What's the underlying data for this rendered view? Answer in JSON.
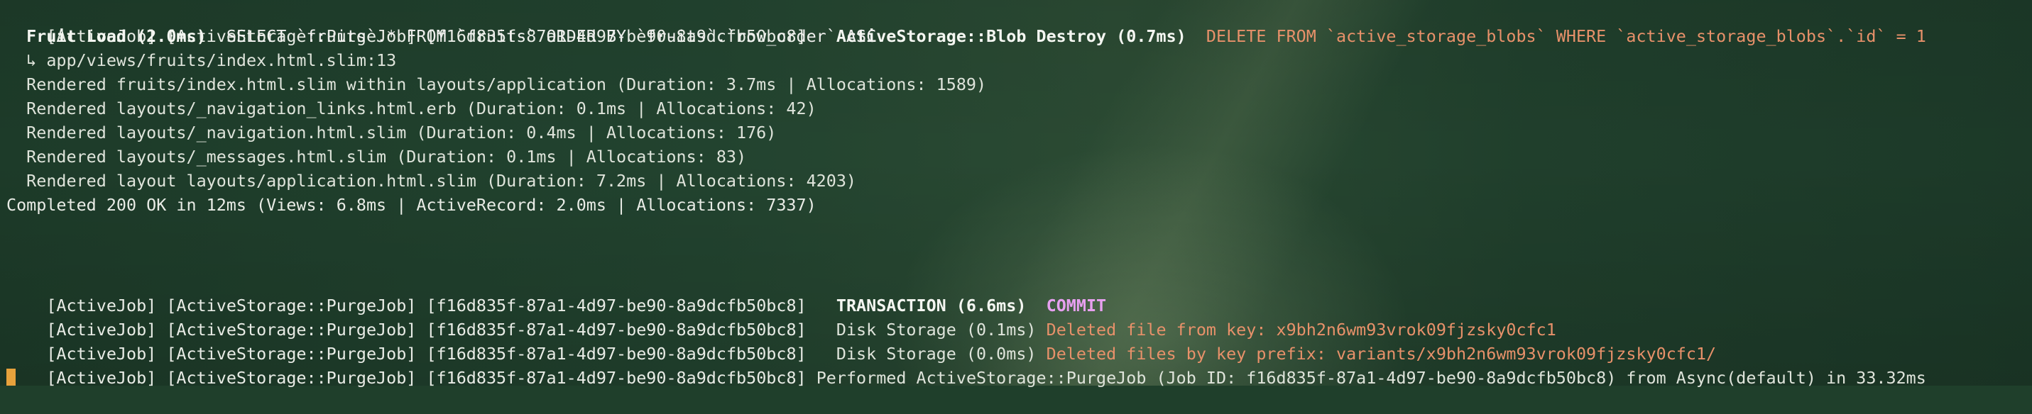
{
  "terminal": {
    "lines": [
      {
        "prefix": "[ActiveJob] [ActiveStorage::PurgeJob] [f16d835f-87a1-4d97-be90-8a9dcfb50bc8]",
        "label": "ActiveStorage::Blob Destroy (0.7ms)",
        "sql": "DELETE FROM `active_storage_blobs` WHERE `active_storage_blobs`.`id` = 1"
      },
      {
        "label": "Fruit Load (2.0ms)",
        "sql": "SELECT `fruits`.* FROM `fruits` ORDER BY `fruits`.`row_order` ASC"
      },
      {
        "text": "  ↳ app/views/fruits/index.html.slim:13"
      },
      {
        "text": "  Rendered fruits/index.html.slim within layouts/application (Duration: 3.7ms | Allocations: 1589)"
      },
      {
        "text": "  Rendered layouts/_navigation_links.html.erb (Duration: 0.1ms | Allocations: 42)"
      },
      {
        "text": "  Rendered layouts/_navigation.html.slim (Duration: 0.4ms | Allocations: 176)"
      },
      {
        "text": "  Rendered layouts/_messages.html.slim (Duration: 0.1ms | Allocations: 83)"
      },
      {
        "text": "  Rendered layout layouts/application.html.slim (Duration: 7.2ms | Allocations: 4203)"
      },
      {
        "text": "Completed 200 OK in 12ms (Views: 6.8ms | ActiveRecord: 2.0ms | Allocations: 7337)"
      },
      {
        "prefix": "[ActiveJob] [ActiveStorage::PurgeJob] [f16d835f-87a1-4d97-be90-8a9dcfb50bc8]",
        "label": "TRANSACTION (6.6ms)",
        "sql": "COMMIT"
      },
      {
        "prefix": "[ActiveJob] [ActiveStorage::PurgeJob] [f16d835f-87a1-4d97-be90-8a9dcfb50bc8]",
        "label": "Disk Storage (0.1ms)",
        "sql": "Deleted file from key: x9bh2n6wm93vrok09fjzsky0cfc1"
      },
      {
        "prefix": "[ActiveJob] [ActiveStorage::PurgeJob] [f16d835f-87a1-4d97-be90-8a9dcfb50bc8]",
        "label": "Disk Storage (0.0ms)",
        "sql": "Deleted files by key prefix: variants/x9bh2n6wm93vrok09fjzsky0cfc1/"
      },
      {
        "prefix": "[ActiveJob] [ActiveStorage::PurgeJob] [f16d835f-87a1-4d97-be90-8a9dcfb50bc8]",
        "text": "Performed ActiveStorage::PurgeJob (Job ID: f16d835f-87a1-4d97-be90-8a9dcfb50bc8) from Async(default) in 33.32ms"
      }
    ]
  },
  "colors": {
    "background": "#1f3f2b",
    "text": "#e9ece6",
    "sql_delete": "#e8916a",
    "sql_commit": "#e7a0f0",
    "cursor": "#e7a23c"
  },
  "icons": {
    "cursor": "terminal-cursor-block"
  }
}
